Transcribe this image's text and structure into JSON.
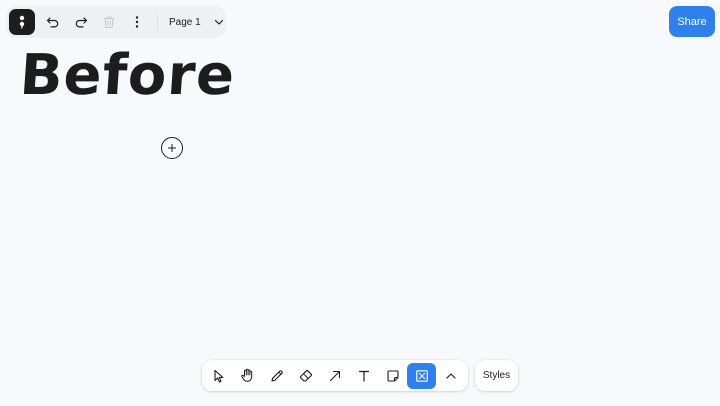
{
  "topbar": {
    "menu_icon": "main-menu-icon",
    "undo_icon": "undo-icon",
    "redo_icon": "redo-icon",
    "delete_icon": "trash-icon",
    "more_icon": "more-vertical-icon",
    "page_label": "Page 1",
    "page_chevron_icon": "chevron-down-icon"
  },
  "share": {
    "label": "Share",
    "color": "#2f80ed"
  },
  "canvas": {
    "text": "Before",
    "cursor_icon": "crosshair-plus-icon"
  },
  "toolbar": {
    "tools": [
      {
        "name": "select",
        "icon": "pointer-icon"
      },
      {
        "name": "hand",
        "icon": "hand-icon"
      },
      {
        "name": "draw",
        "icon": "pencil-icon"
      },
      {
        "name": "eraser",
        "icon": "eraser-icon"
      },
      {
        "name": "arrow",
        "icon": "arrow-icon"
      },
      {
        "name": "text",
        "icon": "text-icon"
      },
      {
        "name": "note",
        "icon": "sticky-note-icon"
      },
      {
        "name": "frame",
        "icon": "frame-icon",
        "active": true
      },
      {
        "name": "more",
        "icon": "chevron-up-icon"
      }
    ],
    "active_color": "#2f80ed",
    "styles_label": "Styles"
  }
}
